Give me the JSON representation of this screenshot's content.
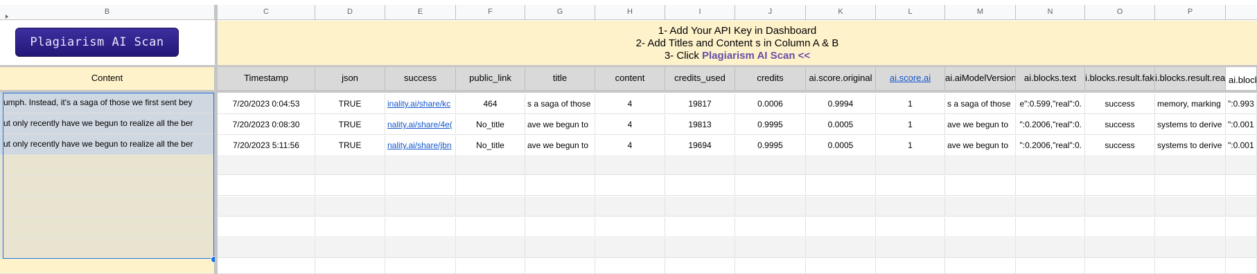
{
  "sheet": {
    "columns": [
      "B",
      "C",
      "D",
      "E",
      "F",
      "G",
      "H",
      "I",
      "J",
      "K",
      "L",
      "M",
      "N",
      "O",
      "P",
      ""
    ],
    "banner": {
      "line1": "1- Add Your API Key in Dashboard",
      "line2": "2- Add Titles and Content s in Column A & B",
      "line3_prefix": "3- Click ",
      "line3_highlight": "Plagiarism AI Scan <<"
    },
    "logo_button": "Plagiarism AI Scan",
    "content_header": "Content",
    "headers": [
      "Timestamp",
      "json",
      "success",
      "public_link",
      "title",
      "content",
      "credits_used",
      "credits",
      "ai.score.original",
      "ai.score.ai",
      "ai.aiModelVersion",
      "ai.blocks.text",
      "i.blocks.result.fak",
      "i.blocks.result.rea",
      "ai.block"
    ],
    "content_cells": [
      "umph. Instead, it's a saga of those we first sent bey",
      "ut only recently have we begun to realize all the ber",
      "ut only recently have we begun to realize all the ber"
    ],
    "rows": [
      [
        "7/20/2023 0:04:53",
        "TRUE",
        "inality.ai/share/kc",
        "464",
        "s a saga of those",
        "4",
        "19817",
        "0.0006",
        "0.9994",
        "1",
        "s a saga of those",
        "e\":0.599,\"real\":0.",
        "success",
        "memory, marking",
        "\":0.993"
      ],
      [
        "7/20/2023 0:08:30",
        "TRUE",
        "nality.ai/share/4e(",
        "No_title",
        "ave we begun to",
        "4",
        "19813",
        "0.9995",
        "0.0005",
        "1",
        "ave we begun to",
        "\":0.2006,\"real\":0.",
        "success",
        "systems to derive",
        "\":0.001"
      ],
      [
        "7/20/2023 5:11:56",
        "TRUE",
        "nality.ai/share/jbn",
        "No_title",
        "ave we begun to",
        "4",
        "19694",
        "0.9995",
        "0.0005",
        "1",
        "ave we begun to",
        "\":0.2006,\"real\":0.",
        "success",
        "systems to derive",
        "\":0.001"
      ]
    ]
  }
}
